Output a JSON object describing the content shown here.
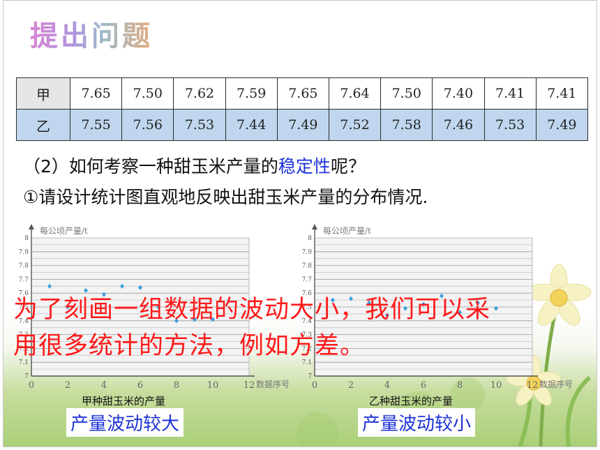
{
  "title": "提出问题",
  "table": {
    "rows": [
      {
        "label": "甲",
        "values": [
          "7.65",
          "7.50",
          "7.62",
          "7.59",
          "7.65",
          "7.64",
          "7.50",
          "7.40",
          "7.41",
          "7.41"
        ]
      },
      {
        "label": "乙",
        "values": [
          "7.55",
          "7.56",
          "7.53",
          "7.44",
          "7.49",
          "7.52",
          "7.58",
          "7.46",
          "7.53",
          "7.49"
        ]
      }
    ]
  },
  "question": {
    "prefix": "（2）如何考察一种甜玉米产量的",
    "highlight": "稳定性",
    "suffix": "呢？"
  },
  "task": "①请设计统计图直观地反映出甜玉米产量的分布情况.",
  "overlay_text": {
    "line1": "为了刻画一组数据的波动大小，我们可以采",
    "line2": "用很多统计的方法，例如方差。"
  },
  "chart_data": [
    {
      "type": "scatter",
      "ylabel": "每公顷产量/t",
      "xlabel": "数据序号",
      "xlim": [
        0,
        12
      ],
      "ylim": [
        7,
        8
      ],
      "xticks": [
        "0",
        "2",
        "4",
        "6",
        "8",
        "10",
        "12"
      ],
      "yticks": [
        "7",
        "7.1",
        "7.2",
        "7.3",
        "7.4",
        "7.5",
        "7.6",
        "7.7",
        "7.8",
        "7.9",
        "8"
      ],
      "x": [
        1,
        2,
        3,
        4,
        5,
        6,
        7,
        8,
        9,
        10
      ],
      "y": [
        7.65,
        7.5,
        7.62,
        7.59,
        7.65,
        7.64,
        7.5,
        7.4,
        7.41,
        7.41
      ],
      "grid": true,
      "caption": "甲种甜玉米的产量",
      "verdict": "产量波动较大",
      "point_color": "#3aa0e0"
    },
    {
      "type": "scatter",
      "ylabel": "每公顷产量/t",
      "xlabel": "数据序号",
      "xlim": [
        0,
        12
      ],
      "ylim": [
        7,
        8
      ],
      "xticks": [
        "0",
        "2",
        "4",
        "6",
        "8",
        "10",
        "12"
      ],
      "yticks": [
        "7",
        "7.1",
        "7.2",
        "7.3",
        "7.4",
        "7.5",
        "7.6",
        "7.7",
        "7.8",
        "7.9",
        "8"
      ],
      "x": [
        1,
        2,
        3,
        4,
        5,
        6,
        7,
        8,
        9,
        10
      ],
      "y": [
        7.55,
        7.56,
        7.53,
        7.44,
        7.49,
        7.52,
        7.58,
        7.46,
        7.53,
        7.49
      ],
      "grid": true,
      "caption": "乙种甜玉米的产量",
      "verdict": "产量波动较小",
      "point_color": "#3aa0e0"
    }
  ]
}
